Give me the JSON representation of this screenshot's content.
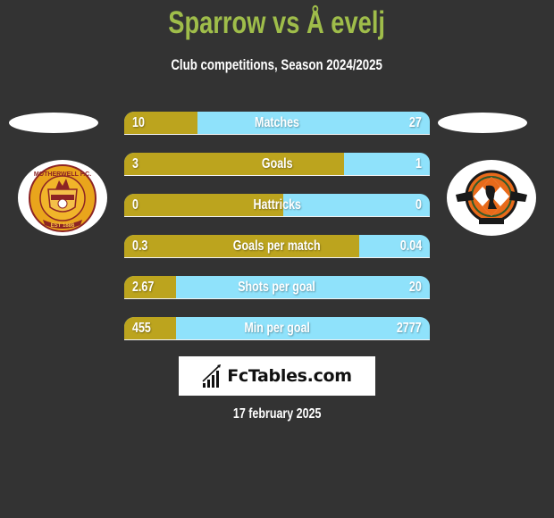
{
  "header": {
    "title": "Sparrow vs Å evelj",
    "subtitle": "Club competitions, Season 2024/2025"
  },
  "teams": {
    "left": {
      "logo_icon": "motherwell-fc-crest-icon",
      "crest_text": "MOTHERWELL F.C.",
      "crest_est": "EST 1886"
    },
    "right": {
      "logo_icon": "dundee-united-crest-icon"
    }
  },
  "colors": {
    "background": "#333333",
    "title": "#9fbd4a",
    "left_bar": "#bca41e",
    "right_bar": "#8fe2fb"
  },
  "stats": [
    {
      "label": "Matches",
      "left": "10",
      "right": "27",
      "left_share": 0.24
    },
    {
      "label": "Goals",
      "left": "3",
      "right": "1",
      "left_share": 0.72
    },
    {
      "label": "Hattricks",
      "left": "0",
      "right": "0",
      "left_share": 0.52
    },
    {
      "label": "Goals per match",
      "left": "0.3",
      "right": "0.04",
      "left_share": 0.77
    },
    {
      "label": "Shots per goal",
      "left": "2.67",
      "right": "20",
      "left_share": 0.17
    },
    {
      "label": "Min per goal",
      "left": "455",
      "right": "2777",
      "left_share": 0.17
    }
  ],
  "brand": {
    "icon": "bar-chart-icon",
    "text": "FcTables.com"
  },
  "date": "17 february 2025"
}
